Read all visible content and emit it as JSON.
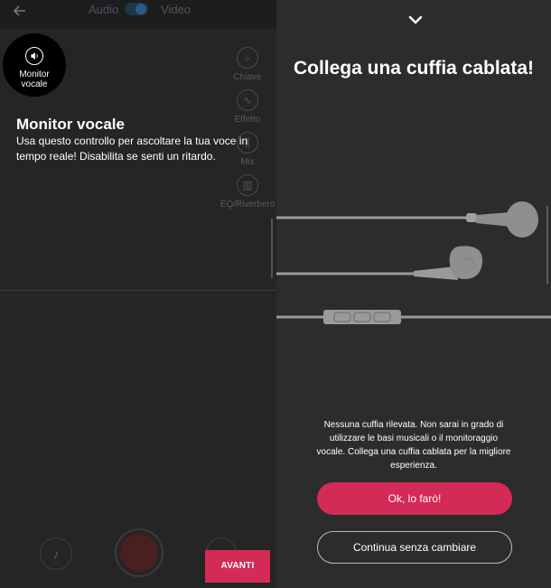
{
  "left_panel": {
    "header": {
      "audio_label": "Audio",
      "video_label": "Video"
    },
    "side_tools": [
      {
        "label": "Chiave",
        "icon": "key-icon"
      },
      {
        "label": "Effetto",
        "icon": "effect-icon"
      },
      {
        "label": "Mix",
        "icon": "mix-icon"
      },
      {
        "label": "EQ/Riverbero",
        "icon": "equalizer-icon"
      }
    ],
    "monitor_button": {
      "line1": "Monitor",
      "line2": "vocale",
      "icon": "speaker-icon"
    },
    "tooltip": {
      "title": "Monitor vocale",
      "text": "Usa questo controllo per ascoltare la tua voce in tempo reale! Disabilita se senti un ritardo."
    },
    "bottom_bar": {
      "music_icon": "music-note-icon",
      "record_icon": "record-icon",
      "next_label": "AVANTI"
    }
  },
  "right_panel": {
    "title": "Collega una cuffia cablata!",
    "message": "Nessuna cuffia rilevata. Non sarai in grado di utilizzare le basi musicali o il monitoraggio vocale. Collega una cuffia cablata per la migliore esperienza.",
    "primary_button": "Ok, lo farò!",
    "secondary_button": "Continua senza cambiare"
  },
  "colors": {
    "accent": "#d42a56",
    "left_background": "#252525",
    "right_background": "#2c2c2c"
  }
}
